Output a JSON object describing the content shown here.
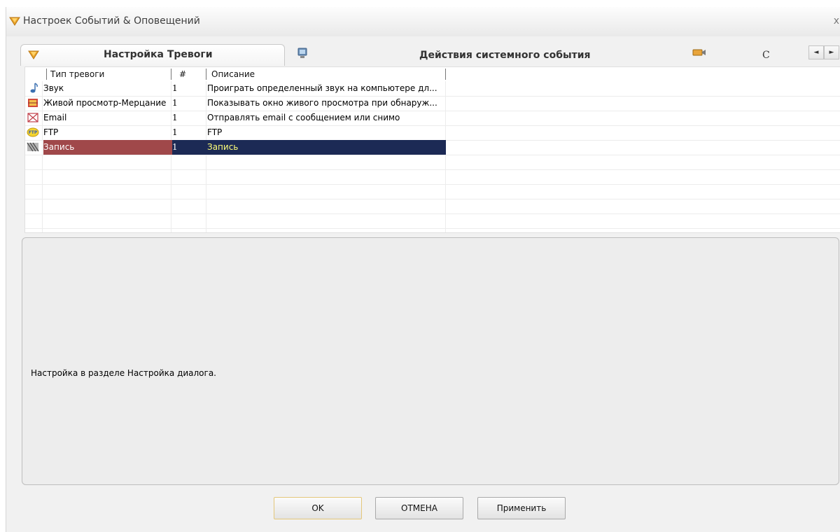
{
  "window": {
    "title": "Настроек Событий & Оповещений",
    "close_glyph": "x"
  },
  "tabs": [
    {
      "label": "Настройка Тревоги",
      "icon": "alarm-bell-icon",
      "active": true
    },
    {
      "label": "Действия системного события",
      "icon": "monitor-icon",
      "active": false
    },
    {
      "label": "С",
      "icon": "camera-icon",
      "active": false
    }
  ],
  "tab_scroll": {
    "left": "◄",
    "right": "►"
  },
  "table": {
    "columns": [
      "Тип тревоги",
      "#",
      "Описание"
    ],
    "rows": [
      {
        "icon": "music-note-icon",
        "type": "Звук",
        "num": "1",
        "desc": "Проиграть определенный звук на компьютере дл..."
      },
      {
        "icon": "live-view-flash-icon",
        "type": "Живой просмотр-Мерцание",
        "num": "1",
        "desc": "Показывать окно живого просмотра при обнаруж..."
      },
      {
        "icon": "envelope-icon",
        "type": "Email",
        "num": "1",
        "desc": "Отправлять email с сообщением или снимо"
      },
      {
        "icon": "ftp-icon",
        "type": "FTP",
        "num": "1",
        "desc": "FTP"
      },
      {
        "icon": "record-icon",
        "type": "Запись",
        "num": "1",
        "desc": "Запись",
        "selected": true
      }
    ]
  },
  "detail": {
    "text": "Настройка в разделе Настройка диалога."
  },
  "buttons": {
    "ok": "OK",
    "cancel": "ОТМЕНА",
    "apply": "Применить"
  },
  "colors": {
    "selected_type_bg": "#a0484a",
    "selected_row_bg": "#1c2a55",
    "selected_desc_text": "#ffff7a"
  }
}
